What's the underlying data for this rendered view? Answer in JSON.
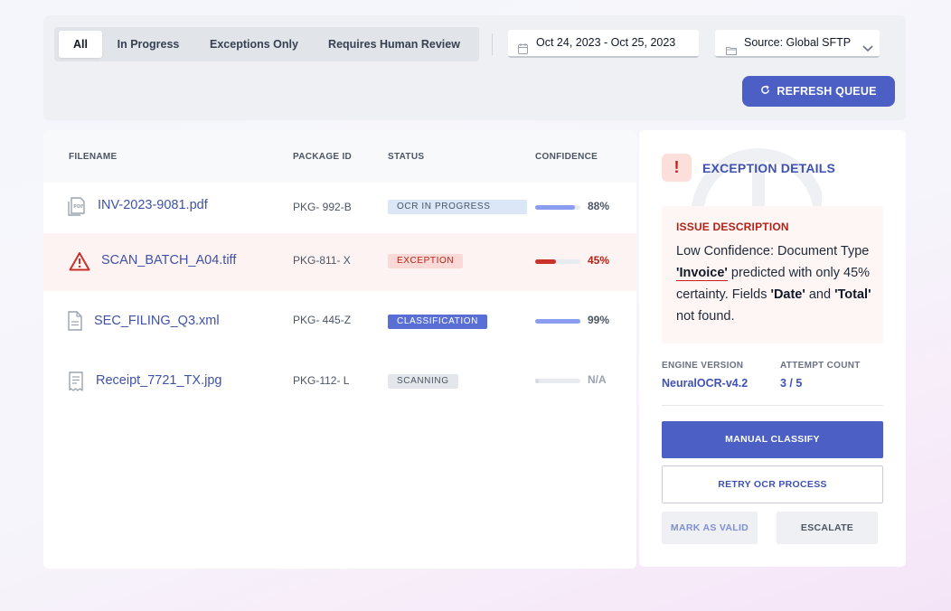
{
  "filters": {
    "tabs": [
      {
        "label": "All",
        "active": true
      },
      {
        "label": "In Progress",
        "active": false
      },
      {
        "label": "Exceptions Only",
        "active": false
      },
      {
        "label": "Requires Human Review",
        "active": false
      }
    ],
    "date_range": "Oct 24, 2023 - Oct 25, 2023",
    "source": "Source: Global SFTP",
    "refresh_label": "REFRESH QUEUE"
  },
  "table": {
    "columns": [
      "FILENAME",
      "PACKAGE ID",
      "STATUS",
      "CONFIDENCE"
    ],
    "rows": [
      {
        "filename": "INV-2023-9081.pdf",
        "package_id": "PKG- 992-B",
        "status": "OCR IN PROGRESS",
        "confidence": "88%",
        "confidence_level": 0.88,
        "icon": "pdf-file-icon"
      },
      {
        "filename": "SCAN_BATCH_A04.tiff",
        "package_id": "PKG-811- X",
        "status": "EXCEPTION",
        "confidence": "45%",
        "confidence_level": 0.45,
        "icon": "warning-icon"
      },
      {
        "filename": "SEC_FILING_Q3.xml",
        "package_id": "PKG- 445-Z",
        "status": "CLASSIFICATION",
        "confidence": "99%",
        "confidence_level": 0.99,
        "icon": "document-icon"
      },
      {
        "filename": "Receipt_7721_TX.jpg",
        "package_id": "PKG-112- L",
        "status": "SCANNING",
        "confidence": "N/A",
        "confidence_level": 0.08,
        "icon": "receipt-icon"
      }
    ]
  },
  "detail": {
    "title": "EXCEPTION DETAILS",
    "alert_glyph": "!",
    "issue_label": "ISSUE DESCRIPTION",
    "issue_text": {
      "part1": "Low Confidence: Document Type ",
      "doc_type": "'Invoice'",
      "part2": " predicted with only 45% certainty. Fields ",
      "field1": "'Date'",
      "part3": " and ",
      "field2": "'Total'",
      "part4": " not found."
    },
    "engine_label": "ENGINE VERSION",
    "engine_value": "NeuralOCR-v4.2",
    "attempt_label": "ATTEMPT COUNT",
    "attempt_value": "3 / 5",
    "buttons": {
      "manual": "MANUAL CLASSIFY",
      "retry": "RETRY OCR PROCESS",
      "valid": "MARK AS VALID",
      "escalate": "ESCALATE"
    }
  },
  "colors": {
    "accent": "#4b5fc4",
    "danger": "#b42318",
    "bar_blue": "#8b9df0",
    "bar_red": "#c8322b"
  }
}
